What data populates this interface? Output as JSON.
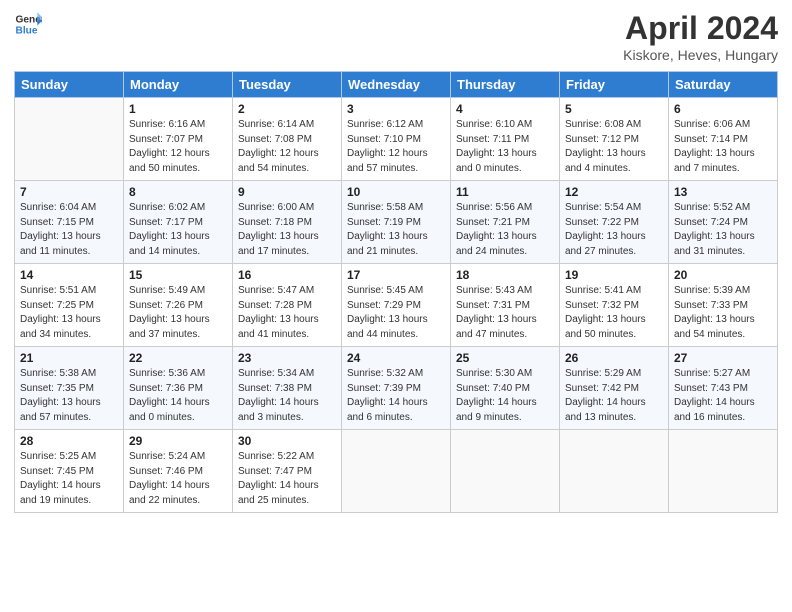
{
  "header": {
    "logo_line1": "General",
    "logo_line2": "Blue",
    "month_title": "April 2024",
    "location": "Kiskore, Heves, Hungary"
  },
  "days_of_week": [
    "Sunday",
    "Monday",
    "Tuesday",
    "Wednesday",
    "Thursday",
    "Friday",
    "Saturday"
  ],
  "weeks": [
    [
      {
        "day": "",
        "info": ""
      },
      {
        "day": "1",
        "info": "Sunrise: 6:16 AM\nSunset: 7:07 PM\nDaylight: 12 hours\nand 50 minutes."
      },
      {
        "day": "2",
        "info": "Sunrise: 6:14 AM\nSunset: 7:08 PM\nDaylight: 12 hours\nand 54 minutes."
      },
      {
        "day": "3",
        "info": "Sunrise: 6:12 AM\nSunset: 7:10 PM\nDaylight: 12 hours\nand 57 minutes."
      },
      {
        "day": "4",
        "info": "Sunrise: 6:10 AM\nSunset: 7:11 PM\nDaylight: 13 hours\nand 0 minutes."
      },
      {
        "day": "5",
        "info": "Sunrise: 6:08 AM\nSunset: 7:12 PM\nDaylight: 13 hours\nand 4 minutes."
      },
      {
        "day": "6",
        "info": "Sunrise: 6:06 AM\nSunset: 7:14 PM\nDaylight: 13 hours\nand 7 minutes."
      }
    ],
    [
      {
        "day": "7",
        "info": "Sunrise: 6:04 AM\nSunset: 7:15 PM\nDaylight: 13 hours\nand 11 minutes."
      },
      {
        "day": "8",
        "info": "Sunrise: 6:02 AM\nSunset: 7:17 PM\nDaylight: 13 hours\nand 14 minutes."
      },
      {
        "day": "9",
        "info": "Sunrise: 6:00 AM\nSunset: 7:18 PM\nDaylight: 13 hours\nand 17 minutes."
      },
      {
        "day": "10",
        "info": "Sunrise: 5:58 AM\nSunset: 7:19 PM\nDaylight: 13 hours\nand 21 minutes."
      },
      {
        "day": "11",
        "info": "Sunrise: 5:56 AM\nSunset: 7:21 PM\nDaylight: 13 hours\nand 24 minutes."
      },
      {
        "day": "12",
        "info": "Sunrise: 5:54 AM\nSunset: 7:22 PM\nDaylight: 13 hours\nand 27 minutes."
      },
      {
        "day": "13",
        "info": "Sunrise: 5:52 AM\nSunset: 7:24 PM\nDaylight: 13 hours\nand 31 minutes."
      }
    ],
    [
      {
        "day": "14",
        "info": "Sunrise: 5:51 AM\nSunset: 7:25 PM\nDaylight: 13 hours\nand 34 minutes."
      },
      {
        "day": "15",
        "info": "Sunrise: 5:49 AM\nSunset: 7:26 PM\nDaylight: 13 hours\nand 37 minutes."
      },
      {
        "day": "16",
        "info": "Sunrise: 5:47 AM\nSunset: 7:28 PM\nDaylight: 13 hours\nand 41 minutes."
      },
      {
        "day": "17",
        "info": "Sunrise: 5:45 AM\nSunset: 7:29 PM\nDaylight: 13 hours\nand 44 minutes."
      },
      {
        "day": "18",
        "info": "Sunrise: 5:43 AM\nSunset: 7:31 PM\nDaylight: 13 hours\nand 47 minutes."
      },
      {
        "day": "19",
        "info": "Sunrise: 5:41 AM\nSunset: 7:32 PM\nDaylight: 13 hours\nand 50 minutes."
      },
      {
        "day": "20",
        "info": "Sunrise: 5:39 AM\nSunset: 7:33 PM\nDaylight: 13 hours\nand 54 minutes."
      }
    ],
    [
      {
        "day": "21",
        "info": "Sunrise: 5:38 AM\nSunset: 7:35 PM\nDaylight: 13 hours\nand 57 minutes."
      },
      {
        "day": "22",
        "info": "Sunrise: 5:36 AM\nSunset: 7:36 PM\nDaylight: 14 hours\nand 0 minutes."
      },
      {
        "day": "23",
        "info": "Sunrise: 5:34 AM\nSunset: 7:38 PM\nDaylight: 14 hours\nand 3 minutes."
      },
      {
        "day": "24",
        "info": "Sunrise: 5:32 AM\nSunset: 7:39 PM\nDaylight: 14 hours\nand 6 minutes."
      },
      {
        "day": "25",
        "info": "Sunrise: 5:30 AM\nSunset: 7:40 PM\nDaylight: 14 hours\nand 9 minutes."
      },
      {
        "day": "26",
        "info": "Sunrise: 5:29 AM\nSunset: 7:42 PM\nDaylight: 14 hours\nand 13 minutes."
      },
      {
        "day": "27",
        "info": "Sunrise: 5:27 AM\nSunset: 7:43 PM\nDaylight: 14 hours\nand 16 minutes."
      }
    ],
    [
      {
        "day": "28",
        "info": "Sunrise: 5:25 AM\nSunset: 7:45 PM\nDaylight: 14 hours\nand 19 minutes."
      },
      {
        "day": "29",
        "info": "Sunrise: 5:24 AM\nSunset: 7:46 PM\nDaylight: 14 hours\nand 22 minutes."
      },
      {
        "day": "30",
        "info": "Sunrise: 5:22 AM\nSunset: 7:47 PM\nDaylight: 14 hours\nand 25 minutes."
      },
      {
        "day": "",
        "info": ""
      },
      {
        "day": "",
        "info": ""
      },
      {
        "day": "",
        "info": ""
      },
      {
        "day": "",
        "info": ""
      }
    ]
  ]
}
